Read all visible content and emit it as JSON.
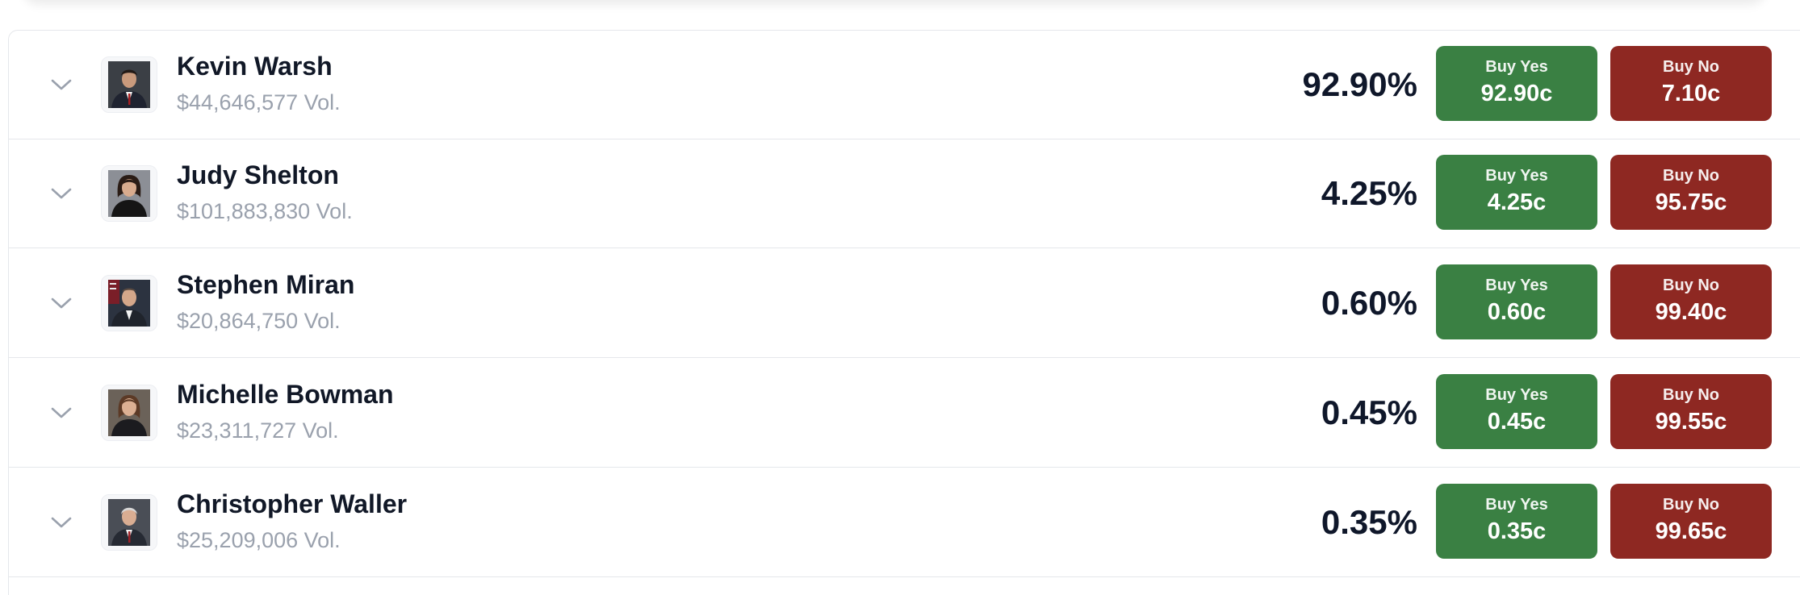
{
  "colors": {
    "yes_button": "#3a8043",
    "no_button": "#8e2822",
    "volume_text": "#9aa1ad",
    "divider": "#e5e7eb"
  },
  "icons": {
    "expand": "chevron-down-icon",
    "avatar": "person-portrait-icon"
  },
  "candidates": [
    {
      "name": "Kevin Warsh",
      "volume": "$44,646,577 Vol.",
      "probability": "92.90%",
      "yes_label": "Buy Yes",
      "yes_price": "92.90c",
      "no_label": "Buy No",
      "no_price": "7.10c"
    },
    {
      "name": "Judy Shelton",
      "volume": "$101,883,830 Vol.",
      "probability": "4.25%",
      "yes_label": "Buy Yes",
      "yes_price": "4.25c",
      "no_label": "Buy No",
      "no_price": "95.75c"
    },
    {
      "name": "Stephen Miran",
      "volume": "$20,864,750 Vol.",
      "probability": "0.60%",
      "yes_label": "Buy Yes",
      "yes_price": "0.60c",
      "no_label": "Buy No",
      "no_price": "99.40c"
    },
    {
      "name": "Michelle Bowman",
      "volume": "$23,311,727 Vol.",
      "probability": "0.45%",
      "yes_label": "Buy Yes",
      "yes_price": "0.45c",
      "no_label": "Buy No",
      "no_price": "99.55c"
    },
    {
      "name": "Christopher Waller",
      "volume": "$25,209,006 Vol.",
      "probability": "0.35%",
      "yes_label": "Buy Yes",
      "yes_price": "0.35c",
      "no_label": "Buy No",
      "no_price": "99.65c"
    }
  ]
}
